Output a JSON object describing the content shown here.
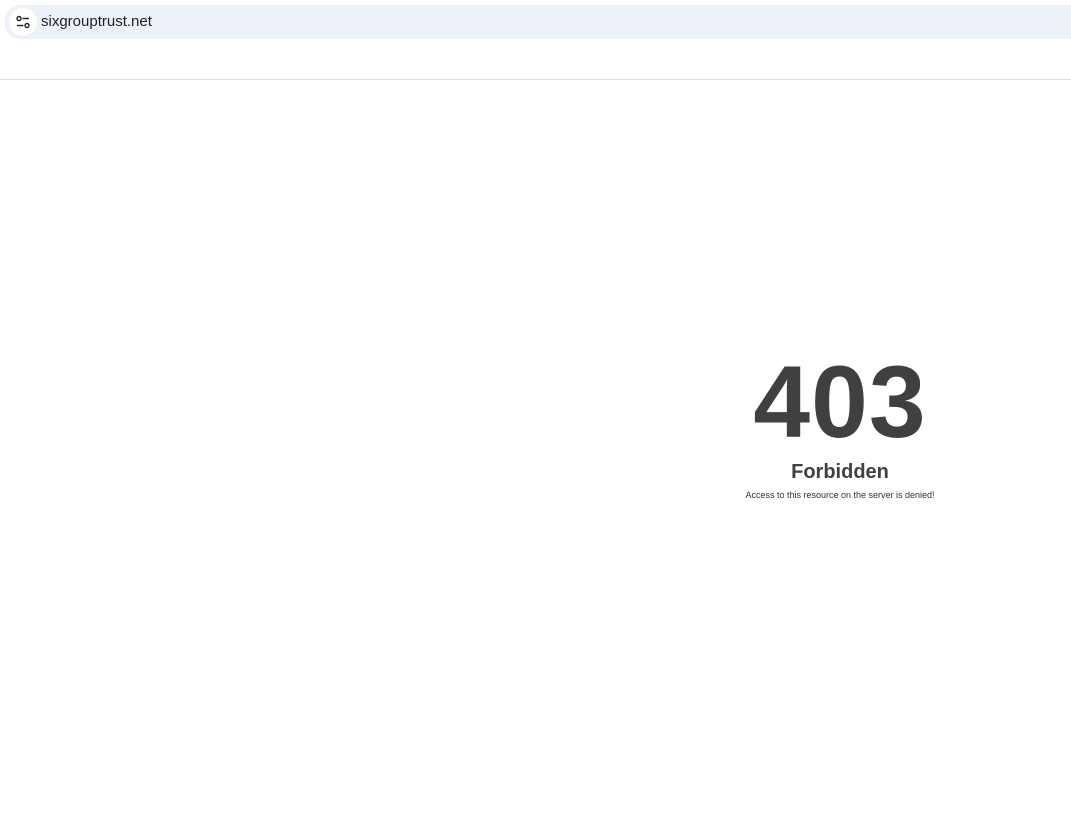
{
  "browser": {
    "url": "sixgrouptrust.net",
    "site_info_icon": "tune-icon"
  },
  "error_page": {
    "code": "403",
    "title": "Forbidden",
    "message": "Access to this resource on the server is denied!",
    "text_color": "#404040"
  },
  "colors": {
    "address_bar_bg": "#edf2fa",
    "page_bg": "#ffffff"
  }
}
